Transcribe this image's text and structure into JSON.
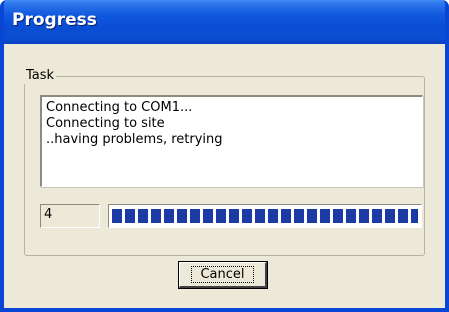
{
  "window": {
    "title": "Progress"
  },
  "task_group": {
    "label": "Task",
    "log_lines": [
      "Connecting to COM1...",
      "Connecting to site",
      "..having problems, retrying"
    ]
  },
  "status": {
    "count": "4",
    "progress_fraction": 1.0
  },
  "buttons": {
    "cancel_label": "Cancel"
  },
  "colors": {
    "titlebar": "#0a4dd4",
    "progress_block": "#1b3aa3",
    "dialog_face": "#ece9d8"
  }
}
